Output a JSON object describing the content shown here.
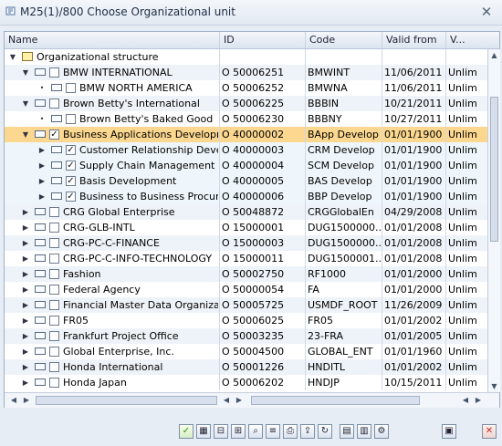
{
  "window": {
    "title": "M25(1)/800 Choose Organizational unit"
  },
  "columns": [
    "Name",
    "ID",
    "Code",
    "Valid from",
    "V..."
  ],
  "rows": [
    {
      "level": 0,
      "icon": "folder",
      "expanded": true,
      "name": "Organizational structure",
      "id": "",
      "code": "",
      "valid_from": "",
      "valid": "",
      "style": "plain"
    },
    {
      "level": 1,
      "icon": "org",
      "expanded": true,
      "checked": false,
      "name": "BMW INTERNATIONAL",
      "id": "O  50006251",
      "code": "BMWINT",
      "valid_from": "11/06/2011",
      "valid": "Unlim",
      "style": "alt"
    },
    {
      "level": 2,
      "icon": "org",
      "expanded": false,
      "checked": false,
      "name": "BMW NORTH AMERICA",
      "id": "O  50006252",
      "code": "BMWNA",
      "valid_from": "11/06/2011",
      "valid": "Unlim",
      "style": "plain"
    },
    {
      "level": 1,
      "icon": "org",
      "expanded": true,
      "checked": false,
      "name": "Brown Betty's International",
      "id": "O  50006225",
      "code": "BBBIN",
      "valid_from": "10/21/2011",
      "valid": "Unlim",
      "style": "alt"
    },
    {
      "level": 2,
      "icon": "org",
      "expanded": false,
      "checked": false,
      "name": "Brown Betty's Baked Good",
      "id": "O  50006230",
      "code": "BBBNY",
      "valid_from": "10/27/2011",
      "valid": "Unlim",
      "style": "plain"
    },
    {
      "level": 1,
      "icon": "org",
      "expanded": true,
      "checked": true,
      "name": "Business Applications Developm",
      "id": "O  40000002",
      "code": "BApp Develop",
      "valid_from": "01/01/1900",
      "valid": "Unlim",
      "style": "selected"
    },
    {
      "level": 2,
      "icon": "org",
      "expanded": false,
      "checked": true,
      "name": "Customer Relationship Deve",
      "id": "O  40000003",
      "code": "CRM Develop",
      "valid_from": "01/01/1900",
      "valid": "Unlim",
      "style": "sub"
    },
    {
      "level": 2,
      "icon": "org",
      "expanded": false,
      "checked": true,
      "name": "Supply Chain Management",
      "id": "O  40000004",
      "code": "SCM Develop",
      "valid_from": "01/01/1900",
      "valid": "Unlim",
      "style": "sub"
    },
    {
      "level": 2,
      "icon": "org",
      "expanded": false,
      "checked": true,
      "name": "Basis Development",
      "id": "O  40000005",
      "code": "BAS Develop",
      "valid_from": "01/01/1900",
      "valid": "Unlim",
      "style": "sub"
    },
    {
      "level": 2,
      "icon": "org",
      "expanded": false,
      "checked": true,
      "name": "Business to Business Procur",
      "id": "O  40000006",
      "code": "BBP Develop",
      "valid_from": "01/01/1900",
      "valid": "Unlim",
      "style": "sub"
    },
    {
      "level": 1,
      "icon": "org",
      "expanded": false,
      "checked": false,
      "name": "CRG Global Enterprise",
      "id": "O  50048872",
      "code": "CRGGlobalEn",
      "valid_from": "04/29/2008",
      "valid": "Unlim",
      "style": "alt"
    },
    {
      "level": 1,
      "icon": "org",
      "expanded": false,
      "checked": false,
      "name": "CRG-GLB-INTL",
      "id": "O  15000001",
      "code": "DUG1500000...",
      "valid_from": "01/01/2008",
      "valid": "Unlim",
      "style": "plain"
    },
    {
      "level": 1,
      "icon": "org",
      "expanded": false,
      "checked": false,
      "name": "CRG-PC-C-FINANCE",
      "id": "O  15000003",
      "code": "DUG1500000...",
      "valid_from": "01/01/2008",
      "valid": "Unlim",
      "style": "alt"
    },
    {
      "level": 1,
      "icon": "org",
      "expanded": false,
      "checked": false,
      "name": "CRG-PC-C-INFO-TECHNOLOGY",
      "id": "O  15000011",
      "code": "DUG1500001...",
      "valid_from": "01/01/2008",
      "valid": "Unlim",
      "style": "plain"
    },
    {
      "level": 1,
      "icon": "org",
      "expanded": false,
      "checked": false,
      "name": "Fashion",
      "id": "O  50002750",
      "code": "RF1000",
      "valid_from": "01/01/2000",
      "valid": "Unlim",
      "style": "alt"
    },
    {
      "level": 1,
      "icon": "org",
      "expanded": false,
      "checked": false,
      "name": "Federal Agency",
      "id": "O  50000054",
      "code": "FA",
      "valid_from": "01/01/2000",
      "valid": "Unlim",
      "style": "plain"
    },
    {
      "level": 1,
      "icon": "org",
      "expanded": false,
      "checked": false,
      "name": "Financial Master Data Organizat",
      "id": "O  50005725",
      "code": "USMDF_ROOT",
      "valid_from": "11/26/2009",
      "valid": "Unlim",
      "style": "alt"
    },
    {
      "level": 1,
      "icon": "org",
      "expanded": false,
      "checked": false,
      "name": "FR05",
      "id": "O  50006025",
      "code": "FR05",
      "valid_from": "01/01/2002",
      "valid": "Unlim",
      "style": "plain"
    },
    {
      "level": 1,
      "icon": "org",
      "expanded": false,
      "checked": false,
      "name": "Frankfurt Project Office",
      "id": "O  50003235",
      "code": "23-FRA",
      "valid_from": "01/01/2005",
      "valid": "Unlim",
      "style": "alt"
    },
    {
      "level": 1,
      "icon": "org",
      "expanded": false,
      "checked": false,
      "name": "Global Enterprise, Inc.",
      "id": "O  50004500",
      "code": "GLOBAL_ENT",
      "valid_from": "01/01/1960",
      "valid": "Unlim",
      "style": "plain"
    },
    {
      "level": 1,
      "icon": "org",
      "expanded": false,
      "checked": false,
      "name": "Honda International",
      "id": "O  50001226",
      "code": "HNDITL",
      "valid_from": "01/01/2002",
      "valid": "Unlim",
      "style": "alt"
    },
    {
      "level": 1,
      "icon": "org",
      "expanded": false,
      "checked": false,
      "name": "Honda Japan",
      "id": "O  50006202",
      "code": "HNDJP",
      "valid_from": "10/15/2011",
      "valid": "Unlim",
      "style": "plain"
    }
  ],
  "colors": {
    "selected": "#fbd78f",
    "accent_ok": "#2f8a1f",
    "accent_cancel": "#c7281f"
  },
  "footer": {
    "icons": [
      "check-icon",
      "tree-icon",
      "collapse-icon",
      "expand-icon",
      "find-icon",
      "filter-icon",
      "print-icon",
      "export-icon",
      "refresh-icon",
      "layout-icon",
      "details-icon",
      "cancel-icon"
    ]
  }
}
